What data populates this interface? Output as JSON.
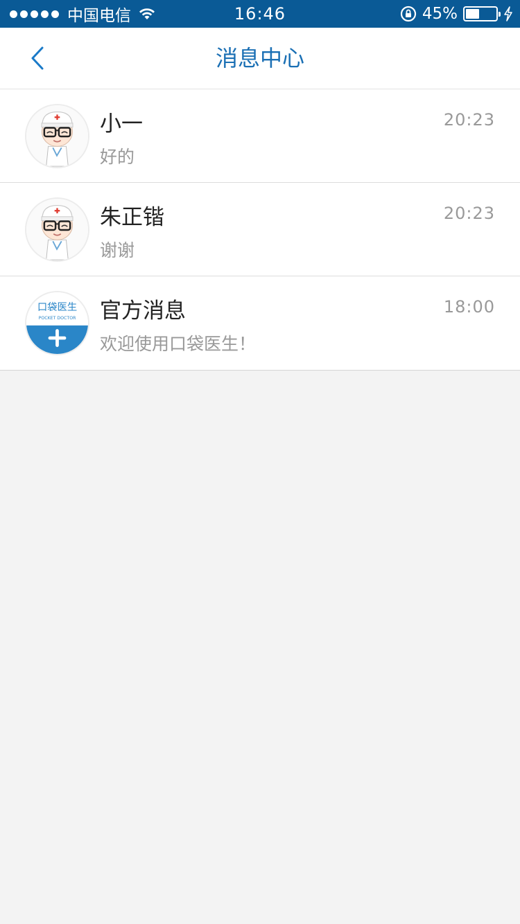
{
  "status_bar": {
    "carrier": "中国电信",
    "time": "16:46",
    "battery_percent_label": "45%",
    "battery_level": 0.45
  },
  "nav": {
    "title": "消息中心",
    "back_icon": "chevron-left-icon"
  },
  "colors": {
    "status_bar_bg": "#0a5a96",
    "accent": "#1a6fb4",
    "background": "#f3f3f3"
  },
  "messages": [
    {
      "name": "小一",
      "preview": "好的",
      "time": "20:23",
      "avatar": "doctor-cartoon-avatar"
    },
    {
      "name": "朱正锴",
      "preview": "谢谢",
      "time": "20:23",
      "avatar": "doctor-cartoon-avatar"
    },
    {
      "name": "官方消息",
      "preview": "欢迎使用口袋医生！",
      "time": "18:00",
      "avatar": "pocket-doctor-logo",
      "logo_text": "口袋医生",
      "logo_subtext": "POCKET DOCTOR"
    }
  ]
}
